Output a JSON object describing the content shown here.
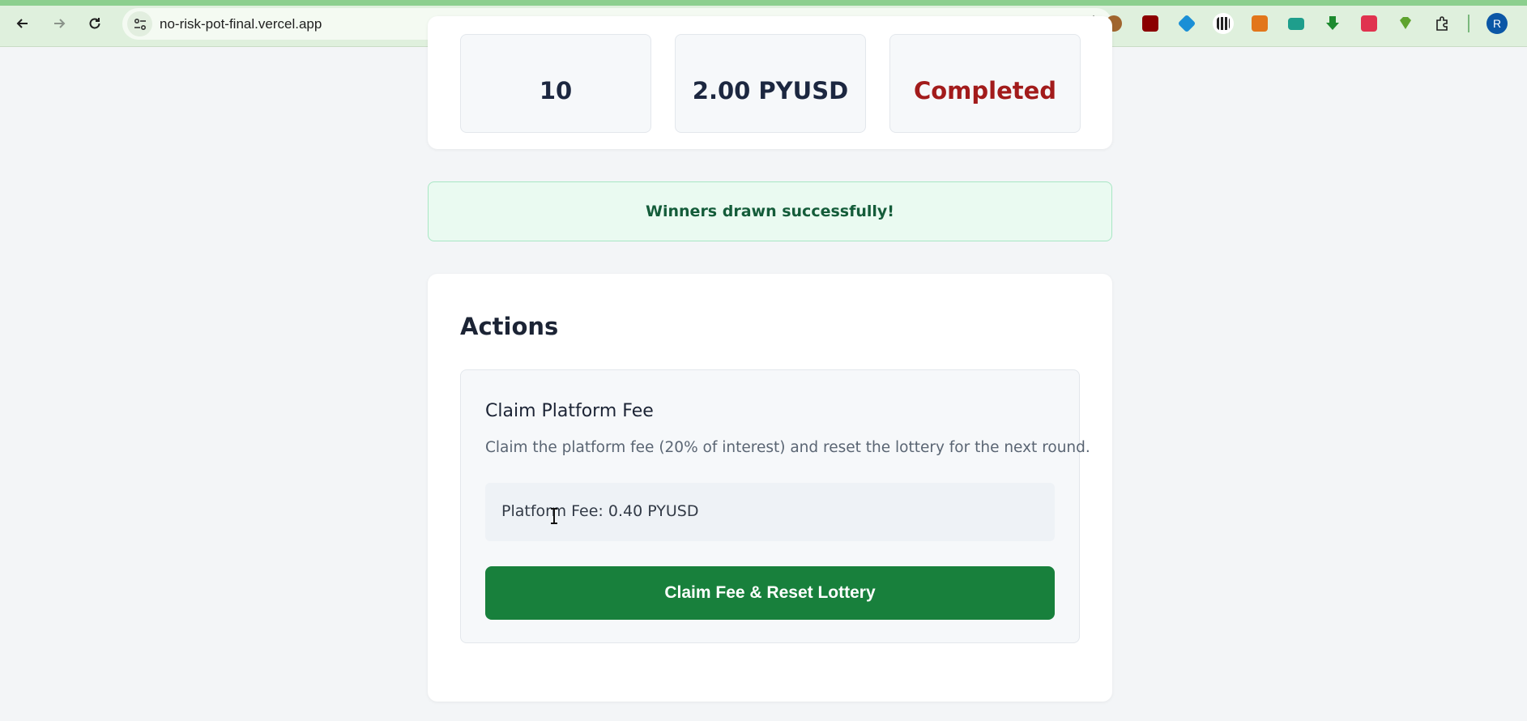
{
  "browser": {
    "url": "no-risk-pot-final.vercel.app",
    "profile_initial": "R",
    "extensions": [
      "cookie-icon",
      "ublock-icon",
      "blue-cube-icon",
      "qr-code-icon",
      "metamask-fox-icon",
      "mail-icon",
      "download-arrow-icon",
      "pocket-save-icon",
      "green-diamond-icon",
      "puzzle-extensions-icon"
    ]
  },
  "stats": [
    {
      "value": "10"
    },
    {
      "value": "2.00 PYUSD"
    },
    {
      "value": "Completed"
    }
  ],
  "alert": {
    "message": "Winners drawn successfully!"
  },
  "actions": {
    "title": "Actions",
    "claim": {
      "title": "Claim Platform Fee",
      "description": "Claim the platform fee (20% of interest) and reset the lottery for the next round.",
      "fee_text": "Platform Fee: 0.40 PYUSD",
      "button_label": "Claim Fee & Reset Lottery"
    }
  },
  "colors": {
    "success_green": "#18803c",
    "completed_red": "#a21b1b",
    "chrome_green": "#dff0dd"
  }
}
